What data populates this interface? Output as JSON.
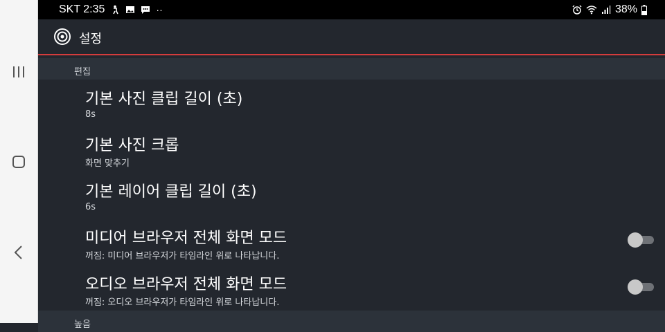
{
  "status_bar": {
    "carrier_time": "SKT 2:35",
    "more": "··",
    "battery": "38%"
  },
  "app_bar": {
    "title": "설정",
    "accent_color": "#d43c3c"
  },
  "sections": [
    {
      "header": "편집"
    },
    {
      "header": "높음"
    }
  ],
  "items": [
    {
      "title": "기본 사진 클립 길이 (초)",
      "subtitle": "8s"
    },
    {
      "title": "기본 사진 크롭",
      "subtitle": "화면 맞추기"
    },
    {
      "title": "기본 레이어 클립 길이 (초)",
      "subtitle": "6s"
    },
    {
      "title": "미디어 브라우저 전체 화면 모드",
      "subtitle": "꺼짐: 미디어 브라우저가 타임라인 위로 나타납니다.",
      "toggle_on": false
    },
    {
      "title": "오디오 브라우저 전체 화면 모드",
      "subtitle": "꺼짐: 오디오 브라우저가 타임라인 위로 나타납니다.",
      "toggle_on": false
    }
  ]
}
